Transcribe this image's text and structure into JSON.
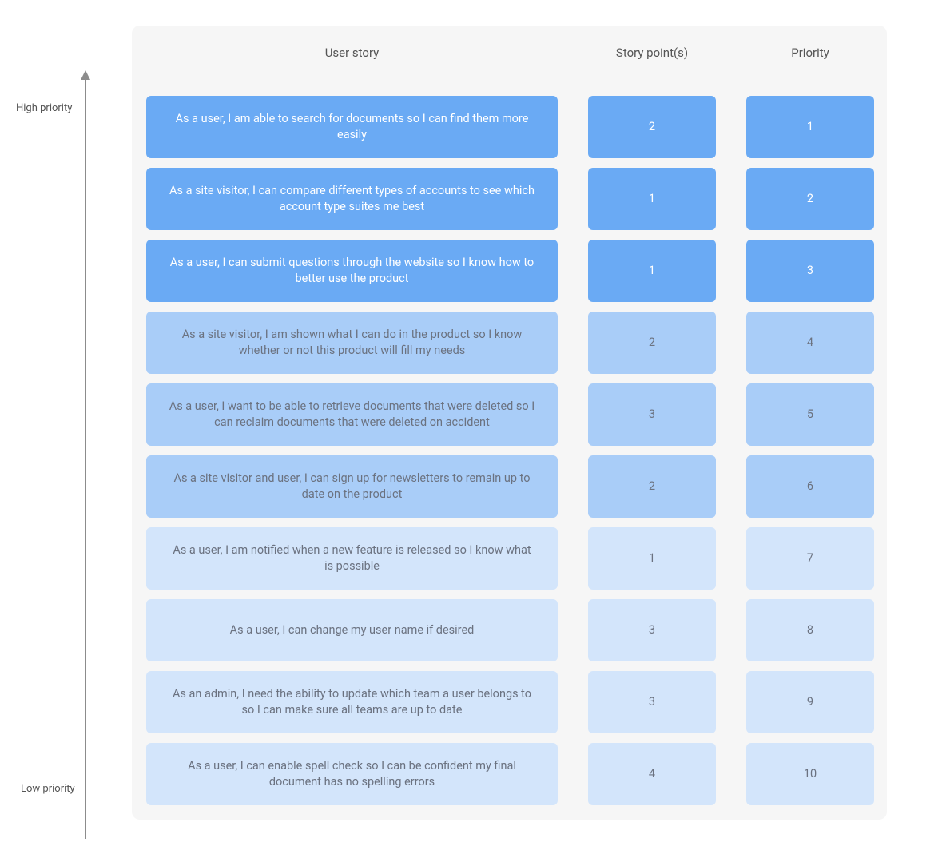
{
  "axis": {
    "high_label": "High priority",
    "low_label": "Low priority"
  },
  "headers": {
    "story": "User story",
    "points": "Story point(s)",
    "priority": "Priority"
  },
  "rows": [
    {
      "story": "As a user, I am able to search for documents so I can find them more easily",
      "points": "2",
      "priority": "1",
      "tier": "tier-1"
    },
    {
      "story": "As a site visitor, I can compare different types of accounts to see which account type suites me best",
      "points": "1",
      "priority": "2",
      "tier": "tier-1"
    },
    {
      "story": "As a user, I can submit questions through the website so I know how to better use the product",
      "points": "1",
      "priority": "3",
      "tier": "tier-1"
    },
    {
      "story": "As a site visitor, I am shown what I can do in the product so I know whether or not this product will fill my needs",
      "points": "2",
      "priority": "4",
      "tier": "tier-2"
    },
    {
      "story": "As a user, I want to be able to retrieve documents that were deleted so I can reclaim documents that were deleted on accident",
      "points": "3",
      "priority": "5",
      "tier": "tier-2"
    },
    {
      "story": "As a site visitor and user, I can sign up for newsletters to remain up to date on the product",
      "points": "2",
      "priority": "6",
      "tier": "tier-2"
    },
    {
      "story": "As a user, I am notified when a new feature is released so I know what is possible",
      "points": "1",
      "priority": "7",
      "tier": "tier-3"
    },
    {
      "story": "As a user, I can change my user name if desired",
      "points": "3",
      "priority": "8",
      "tier": "tier-3"
    },
    {
      "story": "As an admin, I need the ability to update which team a user belongs to so I can make sure all teams are up to date",
      "points": "3",
      "priority": "9",
      "tier": "tier-3"
    },
    {
      "story": "As a user, I can enable spell check so I can be confident my final document has no spelling errors",
      "points": "4",
      "priority": "10",
      "tier": "tier-3"
    }
  ]
}
